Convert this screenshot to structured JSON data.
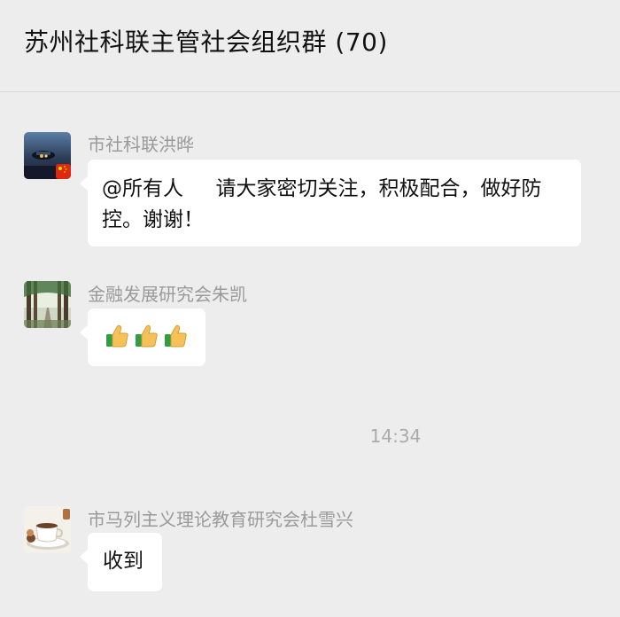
{
  "header": {
    "title": "苏州社科联主管社会组织群 (70)"
  },
  "messages": [
    {
      "sender": "市社科联洪晔",
      "text": "@所有人     请大家密切关注，积极配合，做好防\n控。谢谢！"
    },
    {
      "sender": "金融发展研究会朱凯",
      "emoji_count": 3,
      "emoji_icon": "thumbs-up-icon"
    },
    {
      "sender": "市马列主义理论教育研究会杜雪兴",
      "text": "收到"
    }
  ],
  "timestamp": "14:34",
  "colors": {
    "background": "#ededed",
    "bubble": "#ffffff",
    "sender": "#9a9a9a",
    "timestamp": "#aaaaaa"
  }
}
